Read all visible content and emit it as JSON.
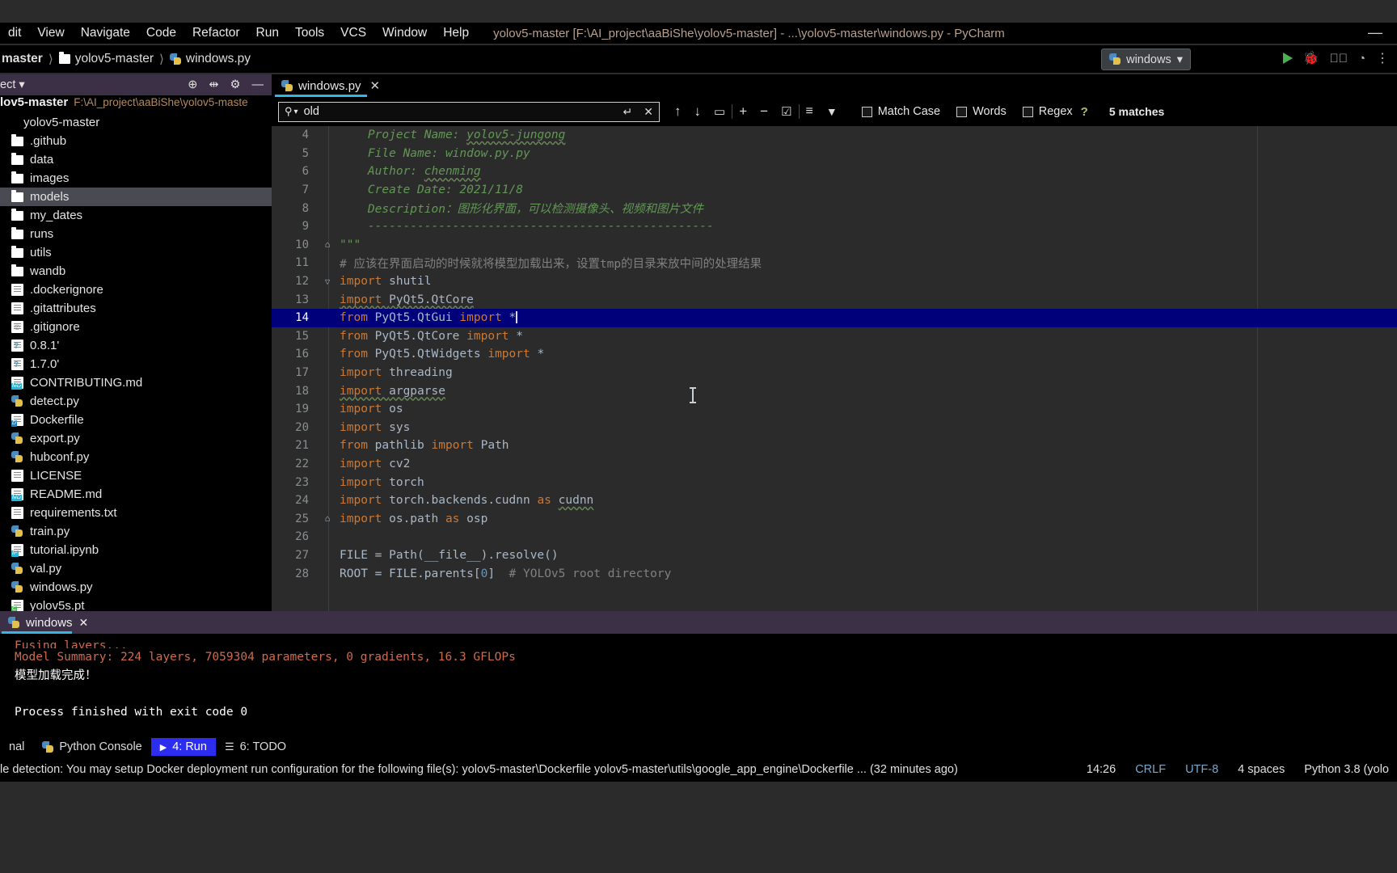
{
  "window": {
    "title": "yolov5-master [F:\\AI_project\\aaBiShe\\yolov5-master] - ...\\yolov5-master\\windows.py - PyCharm",
    "minimize_icon": "minimize-icon"
  },
  "menubar": {
    "items": [
      {
        "label": "dit"
      },
      {
        "label": "View"
      },
      {
        "label": "Navigate"
      },
      {
        "label": "Code"
      },
      {
        "label": "Refactor"
      },
      {
        "label": "Run"
      },
      {
        "label": "Tools"
      },
      {
        "label": "VCS"
      },
      {
        "label": "Window"
      },
      {
        "label": "Help"
      }
    ]
  },
  "breadcrumb": {
    "items": [
      {
        "label": "master",
        "icon": "none"
      },
      {
        "label": "yolov5-master",
        "icon": "folder-icon"
      },
      {
        "label": "windows.py",
        "icon": "python-file-icon"
      }
    ]
  },
  "run_config": {
    "name": "windows",
    "chevron": "▾",
    "icon": "python-run-icon"
  },
  "sidebar": {
    "header_label": "ect",
    "header_chevron": "▾",
    "header_icons": [
      "locate-icon",
      "collapse-all-icon",
      "settings-gear-icon",
      "minimize-icon"
    ],
    "project_root": {
      "name": "lov5-master",
      "path": "F:\\AI_project\\aaBiShe\\yolov5-maste"
    },
    "items": [
      {
        "label": "yolov5-master",
        "icon": "project-module-icon",
        "selected": false,
        "type": "root"
      },
      {
        "label": ".github",
        "icon": "folder-icon",
        "selected": false,
        "type": "folder"
      },
      {
        "label": "data",
        "icon": "folder-icon",
        "selected": false,
        "type": "folder"
      },
      {
        "label": "images",
        "icon": "folder-icon",
        "selected": false,
        "type": "folder"
      },
      {
        "label": "models",
        "icon": "folder-icon",
        "selected": true,
        "type": "folder"
      },
      {
        "label": "my_dates",
        "icon": "folder-icon",
        "selected": false,
        "type": "folder"
      },
      {
        "label": "runs",
        "icon": "folder-icon",
        "selected": false,
        "type": "folder"
      },
      {
        "label": "utils",
        "icon": "folder-icon",
        "selected": false,
        "type": "folder"
      },
      {
        "label": "wandb",
        "icon": "folder-icon",
        "selected": false,
        "type": "folder"
      },
      {
        "label": ".dockerignore",
        "icon": "text-file-icon",
        "selected": false,
        "type": "file"
      },
      {
        "label": ".gitattributes",
        "icon": "text-file-icon",
        "selected": false,
        "type": "file"
      },
      {
        "label": ".gitignore",
        "icon": "gitignore-file-icon",
        "selected": false,
        "type": "file"
      },
      {
        "label": "0.8.1'",
        "icon": "unknown-file-icon",
        "selected": false,
        "type": "file"
      },
      {
        "label": "1.7.0'",
        "icon": "unknown-file-icon",
        "selected": false,
        "type": "file"
      },
      {
        "label": "CONTRIBUTING.md",
        "icon": "markdown-file-icon",
        "selected": false,
        "type": "file"
      },
      {
        "label": "detect.py",
        "icon": "python-file-icon",
        "selected": false,
        "type": "file"
      },
      {
        "label": "Dockerfile",
        "icon": "docker-file-icon",
        "selected": false,
        "type": "file"
      },
      {
        "label": "export.py",
        "icon": "python-file-icon",
        "selected": false,
        "type": "file"
      },
      {
        "label": "hubconf.py",
        "icon": "python-file-icon",
        "selected": false,
        "type": "file"
      },
      {
        "label": "LICENSE",
        "icon": "text-file-icon",
        "selected": false,
        "type": "file"
      },
      {
        "label": "README.md",
        "icon": "markdown-file-icon",
        "selected": false,
        "type": "file"
      },
      {
        "label": "requirements.txt",
        "icon": "text-file-icon",
        "selected": false,
        "type": "file"
      },
      {
        "label": "train.py",
        "icon": "python-file-icon",
        "selected": false,
        "type": "file"
      },
      {
        "label": "tutorial.ipynb",
        "icon": "notebook-file-icon",
        "selected": false,
        "type": "file"
      },
      {
        "label": "val.py",
        "icon": "python-file-icon",
        "selected": false,
        "type": "file"
      },
      {
        "label": "windows.py",
        "icon": "python-file-icon",
        "selected": false,
        "type": "file"
      },
      {
        "label": "yolov5s.pt",
        "icon": "binary-file-icon",
        "selected": false,
        "type": "file"
      }
    ]
  },
  "editor": {
    "tabs": [
      {
        "label": "windows.py",
        "icon": "python-file-icon",
        "active": true,
        "close": "✕"
      }
    ],
    "find": {
      "query": "old",
      "placeholder": "",
      "search_icon": "search-icon",
      "dropdown_icon": "▾",
      "history_icon": "↵",
      "clear_icon": "✕",
      "prev_icon": "↑",
      "next_icon": "↓",
      "select_all_icon": "▭",
      "add_icon": "+",
      "remove_icon": "−",
      "check_icon": "☑",
      "filter_lines_icon": "≡",
      "filter_icon": "▼",
      "help_icon": "?",
      "match_case_label": "Match Case",
      "words_label": "Words",
      "regex_label": "Regex",
      "match_case_checked": false,
      "words_checked": false,
      "regex_checked": false,
      "result_count": "5 matches"
    },
    "lines": [
      {
        "num": "4",
        "fold": "",
        "highlight": false,
        "tokens": [
          {
            "t": "    Project Name: ",
            "c": "c-com"
          },
          {
            "t": "yolov5-jungong",
            "c": "c-com sq"
          }
        ]
      },
      {
        "num": "5",
        "fold": "",
        "highlight": false,
        "tokens": [
          {
            "t": "    File Name: window.py.py",
            "c": "c-com"
          }
        ]
      },
      {
        "num": "6",
        "fold": "",
        "highlight": false,
        "tokens": [
          {
            "t": "    Author: ",
            "c": "c-com"
          },
          {
            "t": "chenming",
            "c": "c-com sq"
          }
        ]
      },
      {
        "num": "7",
        "fold": "",
        "highlight": false,
        "tokens": [
          {
            "t": "    Create Date: 2021/11/8",
            "c": "c-com"
          }
        ]
      },
      {
        "num": "8",
        "fold": "",
        "highlight": false,
        "tokens": [
          {
            "t": "    Description：图形化界面，可以检测摄像头、视频和图片文件",
            "c": "c-com"
          }
        ]
      },
      {
        "num": "9",
        "fold": "",
        "highlight": false,
        "tokens": [
          {
            "t": "    -------------------------------------------------",
            "c": "c-com"
          }
        ]
      },
      {
        "num": "10",
        "fold": "⌂",
        "highlight": false,
        "tokens": [
          {
            "t": "\"\"\"",
            "c": "c-com"
          }
        ]
      },
      {
        "num": "11",
        "fold": "",
        "highlight": false,
        "tokens": [
          {
            "t": "# 应该在界面启动的时候就将模型加载出来，设置tmp的目录来放中间的处理结果",
            "c": "c-hash"
          }
        ]
      },
      {
        "num": "12",
        "fold": "▽",
        "highlight": false,
        "tokens": [
          {
            "t": "import ",
            "c": "c-kw"
          },
          {
            "t": "shutil",
            "c": "c-txt"
          }
        ]
      },
      {
        "num": "13",
        "fold": "",
        "highlight": false,
        "tokens": [
          {
            "t": "import ",
            "c": "c-kw sq"
          },
          {
            "t": "PyQt5.QtCore",
            "c": "c-txt sq"
          }
        ]
      },
      {
        "num": "14",
        "fold": "",
        "highlight": true,
        "tokens": [
          {
            "t": "from ",
            "c": "c-kw"
          },
          {
            "t": "PyQt5.QtGui ",
            "c": "c-txt"
          },
          {
            "t": "import ",
            "c": "c-kw"
          },
          {
            "t": "*",
            "c": "c-txt"
          }
        ],
        "caret": true
      },
      {
        "num": "15",
        "fold": "",
        "highlight": false,
        "tokens": [
          {
            "t": "from ",
            "c": "c-kw"
          },
          {
            "t": "PyQt5.QtCore ",
            "c": "c-txt"
          },
          {
            "t": "import ",
            "c": "c-kw"
          },
          {
            "t": "*",
            "c": "c-txt"
          }
        ]
      },
      {
        "num": "16",
        "fold": "",
        "highlight": false,
        "tokens": [
          {
            "t": "from ",
            "c": "c-kw"
          },
          {
            "t": "PyQt5.QtWidgets ",
            "c": "c-txt"
          },
          {
            "t": "import ",
            "c": "c-kw"
          },
          {
            "t": "*",
            "c": "c-txt"
          }
        ]
      },
      {
        "num": "17",
        "fold": "",
        "highlight": false,
        "tokens": [
          {
            "t": "import ",
            "c": "c-kw"
          },
          {
            "t": "threading",
            "c": "c-txt"
          }
        ]
      },
      {
        "num": "18",
        "fold": "",
        "highlight": false,
        "tokens": [
          {
            "t": "import ",
            "c": "c-kw sq"
          },
          {
            "t": "argparse",
            "c": "c-txt sq"
          }
        ]
      },
      {
        "num": "19",
        "fold": "",
        "highlight": false,
        "tokens": [
          {
            "t": "import ",
            "c": "c-kw"
          },
          {
            "t": "os",
            "c": "c-txt"
          }
        ]
      },
      {
        "num": "20",
        "fold": "",
        "highlight": false,
        "tokens": [
          {
            "t": "import ",
            "c": "c-kw"
          },
          {
            "t": "sys",
            "c": "c-txt"
          }
        ]
      },
      {
        "num": "21",
        "fold": "",
        "highlight": false,
        "tokens": [
          {
            "t": "from ",
            "c": "c-kw"
          },
          {
            "t": "pathlib ",
            "c": "c-txt"
          },
          {
            "t": "import ",
            "c": "c-kw"
          },
          {
            "t": "Path",
            "c": "c-txt"
          }
        ]
      },
      {
        "num": "22",
        "fold": "",
        "highlight": false,
        "tokens": [
          {
            "t": "import ",
            "c": "c-kw"
          },
          {
            "t": "cv2",
            "c": "c-txt"
          }
        ]
      },
      {
        "num": "23",
        "fold": "",
        "highlight": false,
        "tokens": [
          {
            "t": "import ",
            "c": "c-kw"
          },
          {
            "t": "torch",
            "c": "c-txt"
          }
        ]
      },
      {
        "num": "24",
        "fold": "",
        "highlight": false,
        "tokens": [
          {
            "t": "import ",
            "c": "c-kw"
          },
          {
            "t": "torch.backends.cudnn ",
            "c": "c-txt"
          },
          {
            "t": "as ",
            "c": "c-kw"
          },
          {
            "t": "cudnn",
            "c": "c-txt sq"
          }
        ]
      },
      {
        "num": "25",
        "fold": "⌂",
        "highlight": false,
        "tokens": [
          {
            "t": "import ",
            "c": "c-kw"
          },
          {
            "t": "os.path ",
            "c": "c-txt"
          },
          {
            "t": "as ",
            "c": "c-kw"
          },
          {
            "t": "osp",
            "c": "c-txt"
          }
        ]
      },
      {
        "num": "26",
        "fold": "",
        "highlight": false,
        "tokens": [
          {
            "t": "",
            "c": "c-txt"
          }
        ]
      },
      {
        "num": "27",
        "fold": "",
        "highlight": false,
        "tokens": [
          {
            "t": "FILE = Path(__file__).resolve()",
            "c": "c-txt"
          }
        ]
      },
      {
        "num": "28",
        "fold": "",
        "highlight": false,
        "tokens": [
          {
            "t": "ROOT = FILE.parents[",
            "c": "c-txt"
          },
          {
            "t": "0",
            "c": "c-num"
          },
          {
            "t": "]  ",
            "c": "c-txt"
          },
          {
            "t": "# YOLOv5 root directory",
            "c": "c-hash"
          }
        ]
      }
    ]
  },
  "run_panel": {
    "tab_label": "windows",
    "tab_icon": "python-run-icon",
    "tab_close": "✕",
    "output": [
      {
        "text": "Fusing layers...",
        "color": "red",
        "clipped": true
      },
      {
        "text": "Model Summary: 224 layers, 7059304 parameters, 0 gradients, 16.3 GFLOPs",
        "color": "red"
      },
      {
        "text": "模型加载完成！",
        "color": "white"
      },
      {
        "text": "",
        "color": "white"
      },
      {
        "text": "Process finished with exit code 0",
        "color": "white"
      }
    ]
  },
  "toolwindows": {
    "items": [
      {
        "label": "nal",
        "icon": "",
        "active": false
      },
      {
        "label": "Python Console",
        "icon": "python-console-icon",
        "active": false
      },
      {
        "label": "4: Run",
        "icon": "run-play-icon",
        "active": true
      },
      {
        "label": "6: TODO",
        "icon": "todo-list-icon",
        "active": false
      }
    ]
  },
  "statusbar": {
    "message": "le detection: You may setup Docker deployment run configuration for the following file(s): yolov5-master\\Dockerfile yolov5-master\\utils\\google_app_engine\\Dockerfile ... (32 minutes ago)",
    "time": "14:26",
    "line_sep": "CRLF",
    "encoding": "UTF-8",
    "indent": "4 spaces",
    "interpreter": "Python 3.8 (yolo"
  },
  "colors": {
    "accent": "#33b5e5",
    "selection": "#00007a",
    "comment": "#629755",
    "keyword": "#cc7832",
    "number": "#6897bb",
    "console_red": "#cf6a4c",
    "purple_header": "#3c3047"
  }
}
